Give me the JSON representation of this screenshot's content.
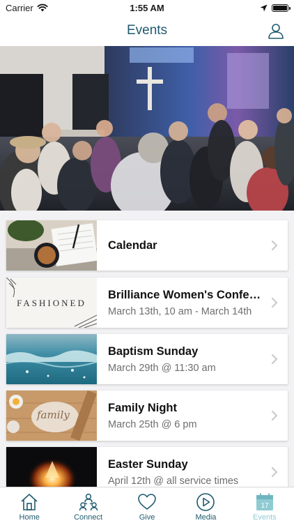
{
  "status_bar": {
    "carrier": "Carrier",
    "time": "1:55 AM"
  },
  "header": {
    "title": "Events"
  },
  "events": [
    {
      "title": "Calendar",
      "subtitle": ""
    },
    {
      "title": "Brilliance Women's Conference",
      "subtitle": "March 13th, 10 am - March 14th",
      "thumb_text": "FASHIONED"
    },
    {
      "title": "Baptism Sunday",
      "subtitle": "March 29th @ 11:30 am"
    },
    {
      "title": "Family Night",
      "subtitle": "March 25th @ 6 pm",
      "thumb_text": "family"
    },
    {
      "title": "Easter Sunday",
      "subtitle": "April 12th @ all service times"
    }
  ],
  "tabs": [
    {
      "label": "Home",
      "icon": "home-icon"
    },
    {
      "label": "Connect",
      "icon": "connect-icon"
    },
    {
      "label": "Give",
      "icon": "heart-icon"
    },
    {
      "label": "Media",
      "icon": "play-icon"
    },
    {
      "label": "Events",
      "icon": "calendar-icon",
      "calendar_day": "17"
    }
  ],
  "colors": {
    "accent": "#1e5a6e",
    "active_tab": "#8fcbd3"
  }
}
